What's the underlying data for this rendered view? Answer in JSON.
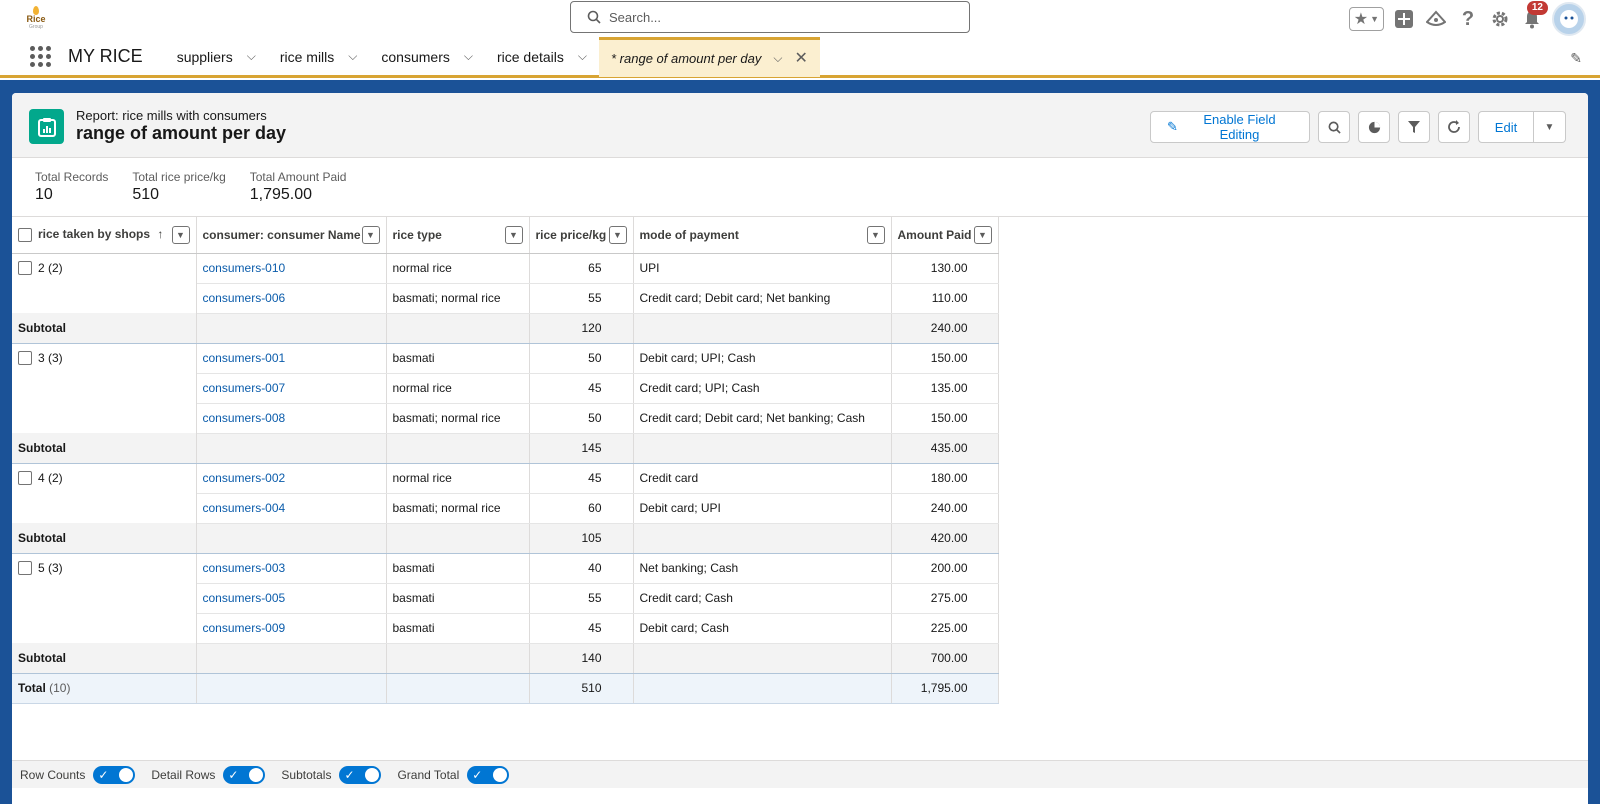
{
  "logo": {
    "text": "Rice",
    "sub": "Group"
  },
  "search": {
    "placeholder": "Search..."
  },
  "notifications": {
    "count": "12"
  },
  "nav": {
    "app_name": "MY RICE",
    "tabs": [
      {
        "label": "suppliers"
      },
      {
        "label": "rice mills"
      },
      {
        "label": "consumers"
      },
      {
        "label": "rice details"
      },
      {
        "label": "* range of amount per day"
      }
    ]
  },
  "report": {
    "subtitle": "Report: rice mills with consumers",
    "title": "range of amount per day",
    "enable_field_editing": "Enable Field Editing",
    "edit": "Edit"
  },
  "summary": [
    {
      "label": "Total Records",
      "value": "10"
    },
    {
      "label": "Total rice price/kg",
      "value": "510"
    },
    {
      "label": "Total Amount Paid",
      "value": "1,795.00"
    }
  ],
  "table": {
    "headers": [
      "rice taken by shops",
      "consumer: consumer Name",
      "rice type",
      "rice price/kg",
      "mode of payment",
      "Amount Paid"
    ],
    "groups": [
      {
        "label": "2 (2)",
        "rows": [
          {
            "name": "consumers-010",
            "type": "normal rice",
            "price": "65",
            "payment": "UPI",
            "amount": "130.00"
          },
          {
            "name": "consumers-006",
            "type": "basmati; normal rice",
            "price": "55",
            "payment": "Credit card; Debit card; Net banking",
            "amount": "110.00"
          }
        ],
        "subtotal_label": "Subtotal",
        "subtotal_price": "120",
        "subtotal_amount": "240.00"
      },
      {
        "label": "3 (3)",
        "rows": [
          {
            "name": "consumers-001",
            "type": "basmati",
            "price": "50",
            "payment": "Debit card; UPI; Cash",
            "amount": "150.00"
          },
          {
            "name": "consumers-007",
            "type": "normal rice",
            "price": "45",
            "payment": "Credit card; UPI; Cash",
            "amount": "135.00"
          },
          {
            "name": "consumers-008",
            "type": "basmati; normal rice",
            "price": "50",
            "payment": "Credit card; Debit card; Net banking; Cash",
            "amount": "150.00"
          }
        ],
        "subtotal_label": "Subtotal",
        "subtotal_price": "145",
        "subtotal_amount": "435.00"
      },
      {
        "label": "4 (2)",
        "rows": [
          {
            "name": "consumers-002",
            "type": "normal rice",
            "price": "45",
            "payment": "Credit card",
            "amount": "180.00"
          },
          {
            "name": "consumers-004",
            "type": "basmati; normal rice",
            "price": "60",
            "payment": "Debit card; UPI",
            "amount": "240.00"
          }
        ],
        "subtotal_label": "Subtotal",
        "subtotal_price": "105",
        "subtotal_amount": "420.00"
      },
      {
        "label": "5 (3)",
        "rows": [
          {
            "name": "consumers-003",
            "type": "basmati",
            "price": "40",
            "payment": "Net banking; Cash",
            "amount": "200.00"
          },
          {
            "name": "consumers-005",
            "type": "basmati",
            "price": "55",
            "payment": "Credit card; Cash",
            "amount": "275.00"
          },
          {
            "name": "consumers-009",
            "type": "basmati",
            "price": "45",
            "payment": "Debit card; Cash",
            "amount": "225.00"
          }
        ],
        "subtotal_label": "Subtotal",
        "subtotal_price": "140",
        "subtotal_amount": "700.00"
      }
    ],
    "total": {
      "label": "Total",
      "count": "(10)",
      "price": "510",
      "amount": "1,795.00"
    }
  },
  "footer": {
    "toggles": [
      {
        "label": "Row Counts",
        "on": true
      },
      {
        "label": "Detail Rows",
        "on": true
      },
      {
        "label": "Subtotals",
        "on": true
      },
      {
        "label": "Grand Total",
        "on": true
      }
    ]
  },
  "colors": {
    "brand_blue": "#1b5297",
    "accent_gold": "#d8a433",
    "report_icon": "#02a88c",
    "link": "#0b5cab"
  }
}
